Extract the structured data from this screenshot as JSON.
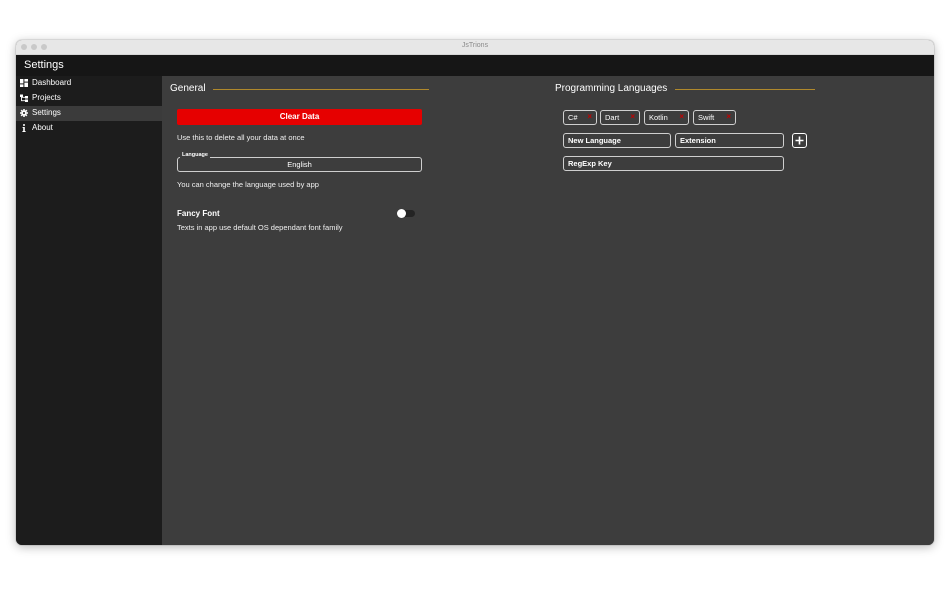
{
  "window": {
    "title": "JsTrions"
  },
  "app": {
    "title": "Settings"
  },
  "sidebar": {
    "items": [
      {
        "label": "Dashboard",
        "icon": "grid-icon",
        "active": false
      },
      {
        "label": "Projects",
        "icon": "tree-icon",
        "active": false
      },
      {
        "label": "Settings",
        "icon": "gear-icon",
        "active": true
      },
      {
        "label": "About",
        "icon": "info-icon",
        "active": false
      }
    ]
  },
  "general": {
    "title": "General",
    "clear_data_label": "Clear Data",
    "clear_data_help": "Use this to delete all your data at once",
    "language_legend": "Language",
    "language_value": "English",
    "language_help": "You can change the language used by app",
    "fancy_font_title": "Fancy Font",
    "fancy_font_help": "Texts in app use default OS dependant font family",
    "fancy_font_enabled": false
  },
  "programming": {
    "title": "Programming Languages",
    "languages": [
      "C#",
      "Dart",
      "Kotlin",
      "Swift"
    ],
    "new_language_placeholder": "New Language",
    "extension_placeholder": "Extension",
    "regexp_placeholder": "RegExp Key"
  },
  "colors": {
    "accent_line": "#b0892c",
    "danger": "#e60000",
    "chip_remove": "#c40000",
    "sidebar_bg": "#1c1c1c",
    "content_bg": "#3d3d3d"
  }
}
